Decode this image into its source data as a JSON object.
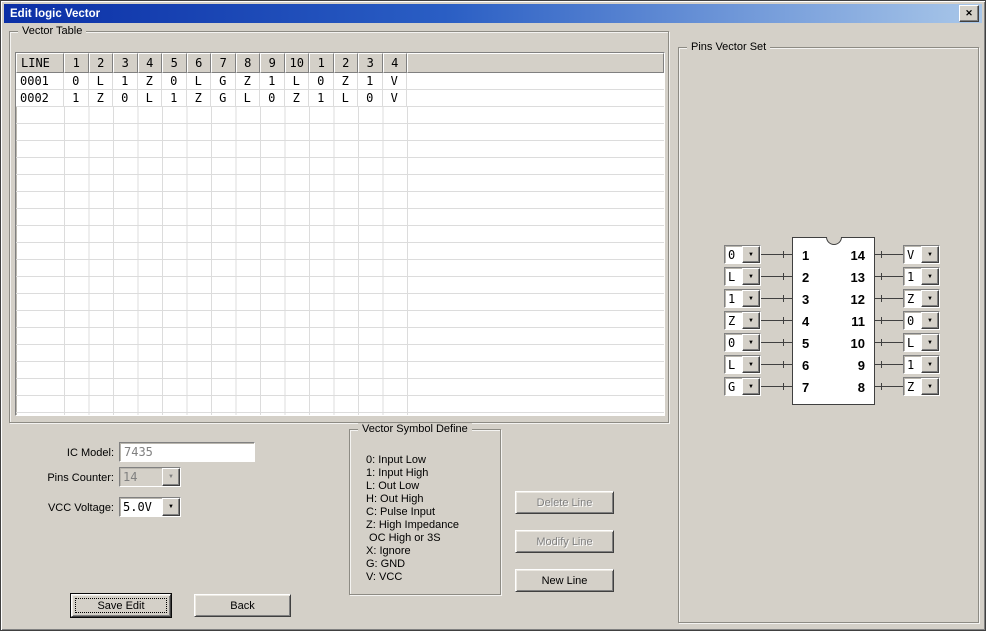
{
  "window": {
    "title": "Edit logic Vector"
  },
  "icons": {
    "close": "✕",
    "chevron_down": "▼"
  },
  "vector_table": {
    "group_label": "Vector Table",
    "headers": [
      "LINE",
      "1",
      "2",
      "3",
      "4",
      "5",
      "6",
      "7",
      "8",
      "9",
      "10",
      "1",
      "2",
      "3",
      "4"
    ],
    "rows": [
      {
        "line": "0001",
        "values": [
          "0",
          "L",
          "1",
          "Z",
          "0",
          "L",
          "G",
          "Z",
          "1",
          "L",
          "0",
          "Z",
          "1",
          "V"
        ]
      },
      {
        "line": "0002",
        "values": [
          "1",
          "Z",
          "0",
          "L",
          "1",
          "Z",
          "G",
          "L",
          "0",
          "Z",
          "1",
          "L",
          "0",
          "V"
        ]
      }
    ]
  },
  "form": {
    "ic_model_label": "IC Model:",
    "ic_model_value": "7435",
    "pins_counter_label": "Pins Counter:",
    "pins_counter_value": "14",
    "vcc_voltage_label": "VCC Voltage:",
    "vcc_voltage_value": "5.0V"
  },
  "symbol_define": {
    "group_label": "Vector Symbol Define",
    "lines": [
      "0: Input Low",
      "1: Input High",
      "L: Out Low",
      "H: Out High",
      "C: Pulse Input",
      "Z: High Impedance",
      " OC High or 3S",
      "X: Ignore",
      "G: GND",
      "V: VCC"
    ]
  },
  "buttons": {
    "delete_line": "Delete Line",
    "modify_line": "Modify Line",
    "new_line": "New Line",
    "save_edit": "Save Edit",
    "back": "Back"
  },
  "pins_vector_set": {
    "group_label": "Pins Vector Set",
    "left_pins": [
      {
        "num": "1",
        "value": "0"
      },
      {
        "num": "2",
        "value": "L"
      },
      {
        "num": "3",
        "value": "1"
      },
      {
        "num": "4",
        "value": "Z"
      },
      {
        "num": "5",
        "value": "0"
      },
      {
        "num": "6",
        "value": "L"
      },
      {
        "num": "7",
        "value": "G"
      }
    ],
    "right_pins": [
      {
        "num": "14",
        "value": "V"
      },
      {
        "num": "13",
        "value": "1"
      },
      {
        "num": "12",
        "value": "Z"
      },
      {
        "num": "11",
        "value": "0"
      },
      {
        "num": "10",
        "value": "L"
      },
      {
        "num": "9",
        "value": "1"
      },
      {
        "num": "8",
        "value": "Z"
      }
    ]
  }
}
